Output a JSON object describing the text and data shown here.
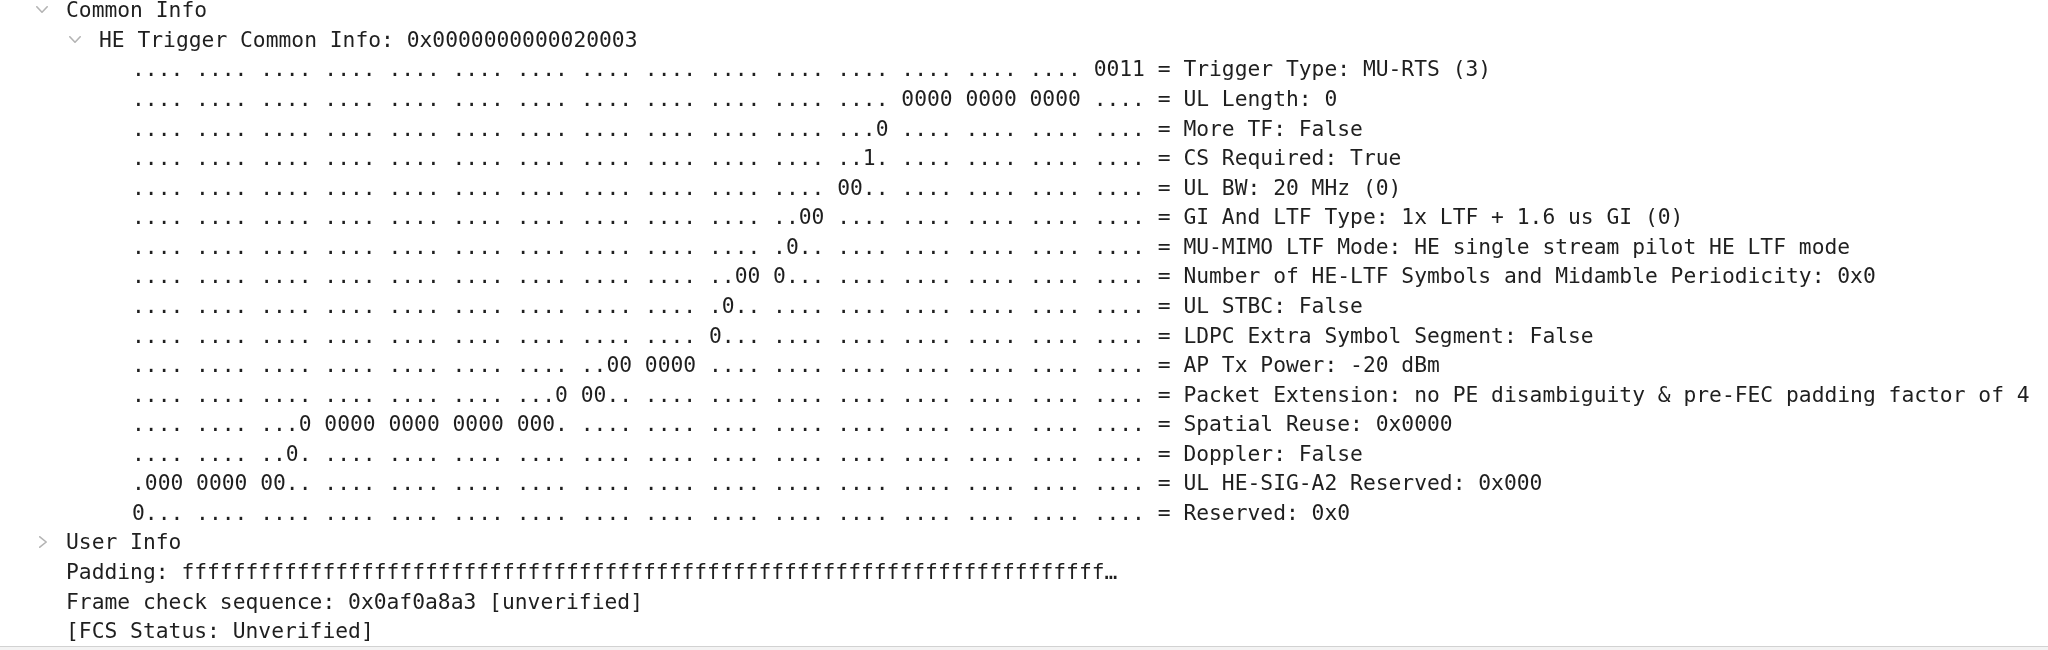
{
  "tree": [
    {
      "label": "Common Info",
      "expanded": true,
      "children": [
        {
          "label": "HE Trigger Common Info: 0x0000000000020003",
          "expanded": true,
          "children": [
            {
              "label": ".... .... .... .... .... .... .... .... .... .... .... .... .... .... .... 0011 = Trigger Type: MU-RTS (3)"
            },
            {
              "label": ".... .... .... .... .... .... .... .... .... .... .... .... 0000 0000 0000 .... = UL Length: 0"
            },
            {
              "label": ".... .... .... .... .... .... .... .... .... .... .... ...0 .... .... .... .... = More TF: False"
            },
            {
              "label": ".... .... .... .... .... .... .... .... .... .... .... ..1. .... .... .... .... = CS Required: True"
            },
            {
              "label": ".... .... .... .... .... .... .... .... .... .... .... 00.. .... .... .... .... = UL BW: 20 MHz (0)"
            },
            {
              "label": ".... .... .... .... .... .... .... .... .... .... ..00 .... .... .... .... .... = GI And LTF Type: 1x LTF + 1.6 us GI (0)"
            },
            {
              "label": ".... .... .... .... .... .... .... .... .... .... .0.. .... .... .... .... .... = MU-MIMO LTF Mode: HE single stream pilot HE LTF mode"
            },
            {
              "label": ".... .... .... .... .... .... .... .... .... ..00 0... .... .... .... .... .... = Number of HE-LTF Symbols and Midamble Periodicity: 0x0"
            },
            {
              "label": ".... .... .... .... .... .... .... .... .... .0.. .... .... .... .... .... .... = UL STBC: False"
            },
            {
              "label": ".... .... .... .... .... .... .... .... .... 0... .... .... .... .... .... .... = LDPC Extra Symbol Segment: False"
            },
            {
              "label": ".... .... .... .... .... .... .... ..00 0000 .... .... .... .... .... .... .... = AP Tx Power: -20 dBm"
            },
            {
              "label": ".... .... .... .... .... .... ...0 00.. .... .... .... .... .... .... .... .... = Packet Extension: no PE disambiguity & pre-FEC padding factor of 4"
            },
            {
              "label": ".... .... ...0 0000 0000 0000 000. .... .... .... .... .... .... .... .... .... = Spatial Reuse: 0x0000"
            },
            {
              "label": ".... .... ..0. .... .... .... .... .... .... .... .... .... .... .... .... .... = Doppler: False"
            },
            {
              "label": ".000 0000 00.. .... .... .... .... .... .... .... .... .... .... .... .... .... = UL HE-SIG-A2 Reserved: 0x000"
            },
            {
              "label": "0... .... .... .... .... .... .... .... .... .... .... .... .... .... .... .... = Reserved: 0x0"
            }
          ]
        }
      ]
    },
    {
      "label": "User Info",
      "expanded": false
    },
    {
      "label": "Padding: ffffffffffffffffffffffffffffffffffffffffffffffffffffffffffffffffffffffff…"
    },
    {
      "label": "Frame check sequence: 0x0af0a8a3 [unverified]"
    },
    {
      "label": "[FCS Status: Unverified]"
    }
  ]
}
